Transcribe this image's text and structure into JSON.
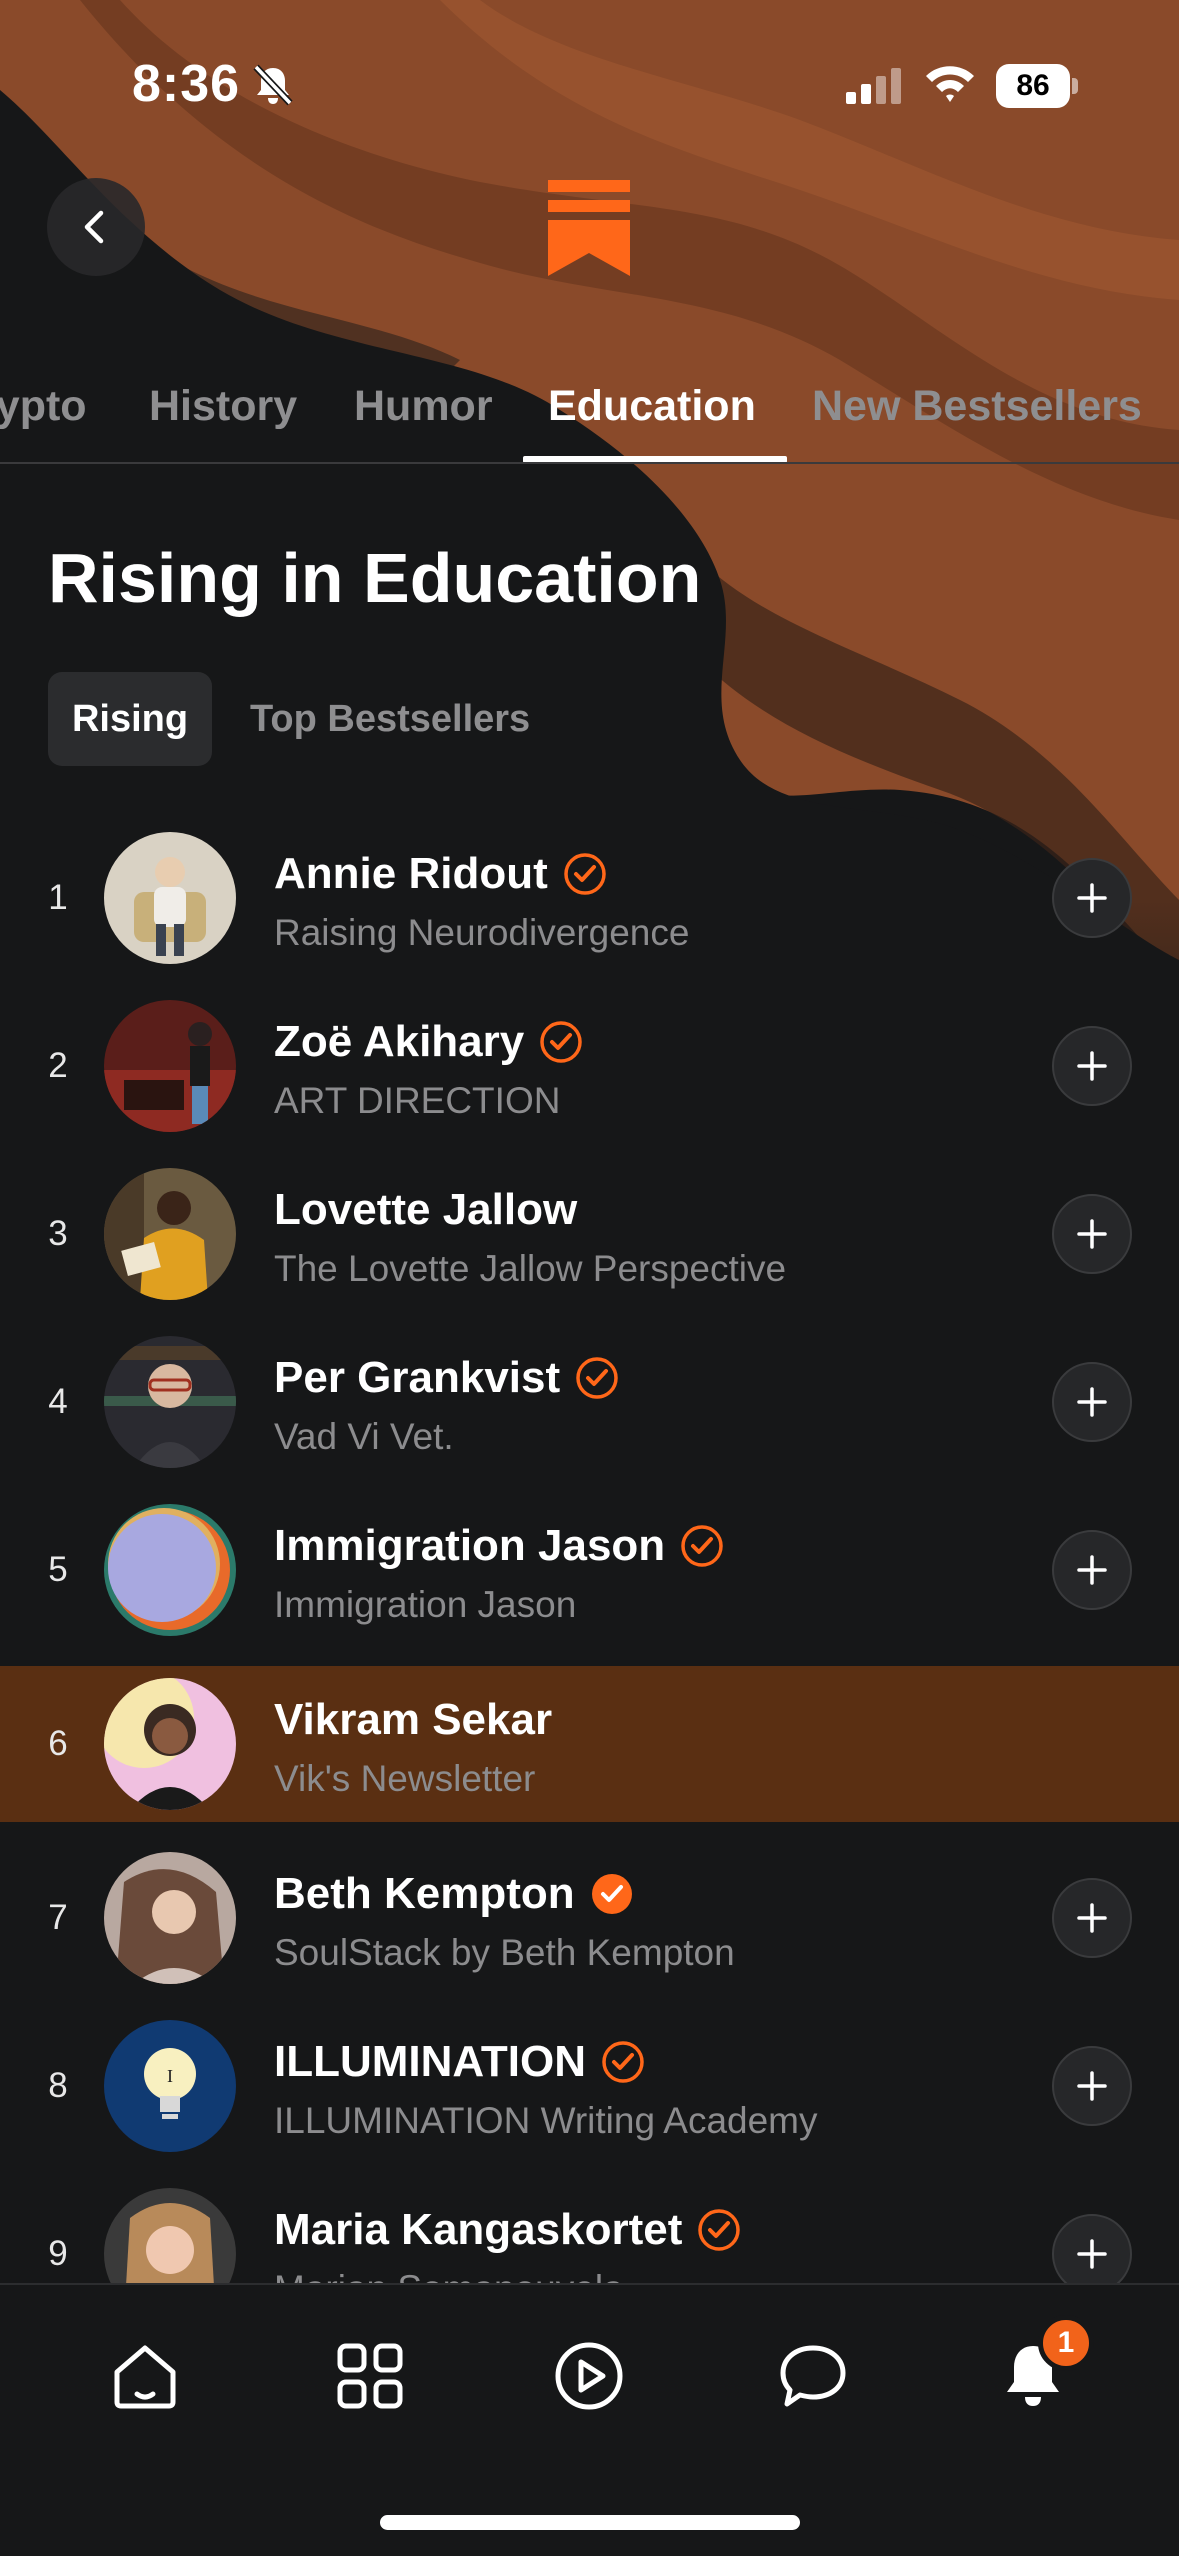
{
  "status_bar": {
    "time": "8:36",
    "battery": "86"
  },
  "colors": {
    "accent": "#FF6719",
    "highlight_row": "#5A2F12",
    "background": "#161718"
  },
  "tabs": [
    {
      "label": "Crypto",
      "active": false
    },
    {
      "label": "History",
      "active": false
    },
    {
      "label": "Humor",
      "active": false
    },
    {
      "label": "Education",
      "active": true
    },
    {
      "label": "New Bestsellers",
      "active": false
    }
  ],
  "section_title": "Rising in Education",
  "segments": {
    "rising": "Rising",
    "top": "Top Bestsellers",
    "selected": "Rising"
  },
  "rows": [
    {
      "rank": "1",
      "name": "Annie Ridout",
      "publication": "Raising Neurodivergence",
      "verified": "outline",
      "following": false
    },
    {
      "rank": "2",
      "name": "Zoë Akihary",
      "publication": "ART DIRECTION",
      "verified": "outline",
      "following": false
    },
    {
      "rank": "3",
      "name": "Lovette Jallow",
      "publication": "The Lovette Jallow Perspective",
      "verified": "none",
      "following": false
    },
    {
      "rank": "4",
      "name": "Per Grankvist",
      "publication": "Vad Vi Vet.",
      "verified": "outline",
      "following": false
    },
    {
      "rank": "5",
      "name": "Immigration Jason",
      "publication": "Immigration Jason",
      "verified": "outline",
      "following": false
    },
    {
      "rank": "6",
      "name": "Vikram Sekar",
      "publication": "Vik's Newsletter",
      "verified": "none",
      "following": true
    },
    {
      "rank": "7",
      "name": "Beth Kempton",
      "publication": "SoulStack by Beth Kempton",
      "verified": "filled",
      "following": false
    },
    {
      "rank": "8",
      "name": "ILLUMINATION",
      "publication": "ILLUMINATION Writing Academy",
      "verified": "outline",
      "following": false
    },
    {
      "rank": "9",
      "name": "Maria Kangaskortet",
      "publication": "Marian Somanouvela",
      "verified": "outline",
      "following": false
    }
  ],
  "icons": {
    "back": "chevron-left-icon",
    "logo": "substack-logo",
    "follow": "plus-icon",
    "nav": [
      "home-icon",
      "grid-icon",
      "play-icon",
      "chat-icon",
      "bell-icon"
    ]
  },
  "bottom_nav": {
    "notification_count": "1"
  }
}
